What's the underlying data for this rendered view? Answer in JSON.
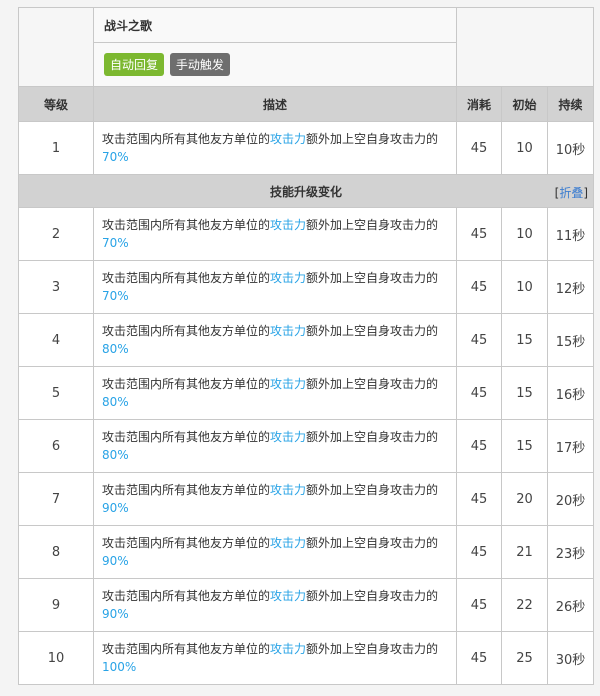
{
  "skill": {
    "name": "战斗之歌",
    "tags": [
      {
        "label": "自动回复",
        "color": "#7cb830"
      },
      {
        "label": "手动触发",
        "color": "#6e6e6e"
      }
    ]
  },
  "headers": {
    "level": "等级",
    "desc": "描述",
    "cost": "消耗",
    "initial": "初始",
    "duration": "持续"
  },
  "upgrade": {
    "title": "技能升级变化",
    "collapse_open": "[",
    "collapse_link": "折叠",
    "collapse_close": "]"
  },
  "desc_parts": {
    "prefix": "攻击范围内所有其他友方单位的",
    "highlight": "攻击力",
    "middle": "额外加上空自身攻击力的"
  },
  "rows": [
    {
      "level": "1",
      "value": "70%",
      "cost": "45",
      "initial": "10",
      "duration": "10秒"
    },
    {
      "level": "2",
      "value": "70%",
      "cost": "45",
      "initial": "10",
      "duration": "11秒"
    },
    {
      "level": "3",
      "value": "70%",
      "cost": "45",
      "initial": "10",
      "duration": "12秒"
    },
    {
      "level": "4",
      "value": "80%",
      "cost": "45",
      "initial": "15",
      "duration": "15秒"
    },
    {
      "level": "5",
      "value": "80%",
      "cost": "45",
      "initial": "15",
      "duration": "16秒"
    },
    {
      "level": "6",
      "value": "80%",
      "cost": "45",
      "initial": "15",
      "duration": "17秒"
    },
    {
      "level": "7",
      "value": "90%",
      "cost": "45",
      "initial": "20",
      "duration": "20秒"
    },
    {
      "level": "8",
      "value": "90%",
      "cost": "45",
      "initial": "21",
      "duration": "23秒"
    },
    {
      "level": "9",
      "value": "90%",
      "cost": "45",
      "initial": "22",
      "duration": "26秒"
    },
    {
      "level": "10",
      "value": "100%",
      "cost": "45",
      "initial": "25",
      "duration": "30秒"
    }
  ],
  "colors": {
    "highlight": "#29a3e6",
    "header_bg": "#d2d2d2",
    "link": "#3c7dd0"
  }
}
